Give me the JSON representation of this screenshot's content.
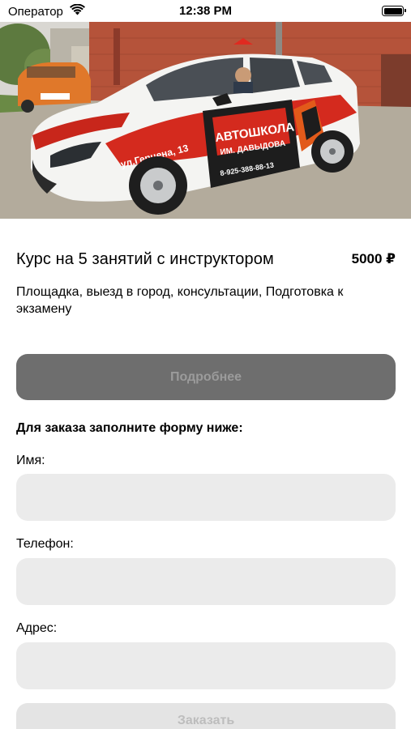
{
  "status_bar": {
    "carrier": "Оператор",
    "time": "12:38 PM"
  },
  "hero": {
    "car_text_street": "ул.Герцена, 13",
    "car_text_school": "АВТОШКОЛА",
    "car_text_name": "ИМ. ДАВЫДОВА",
    "car_text_phone": "8-925-388-88-13"
  },
  "course": {
    "title": "Курс на 5 занятий с инструктором",
    "price": "5000 ₽",
    "description": "Площадка, выезд в город, консультации, Подготовка к экзамену"
  },
  "details_button": {
    "label": "Подробнее"
  },
  "form": {
    "heading": "Для заказа заполните форму ниже:",
    "name_label": "Имя:",
    "name_value": "",
    "phone_label": "Телефон:",
    "phone_value": "",
    "address_label": "Адрес:",
    "address_value": ""
  },
  "order_button": {
    "label": "Заказать"
  },
  "colors": {
    "details_button_bg": "#6e6e6e",
    "input_bg": "#ebebeb",
    "order_button_bg": "#e4e4e4",
    "car_accent_red": "#d42a1e"
  }
}
